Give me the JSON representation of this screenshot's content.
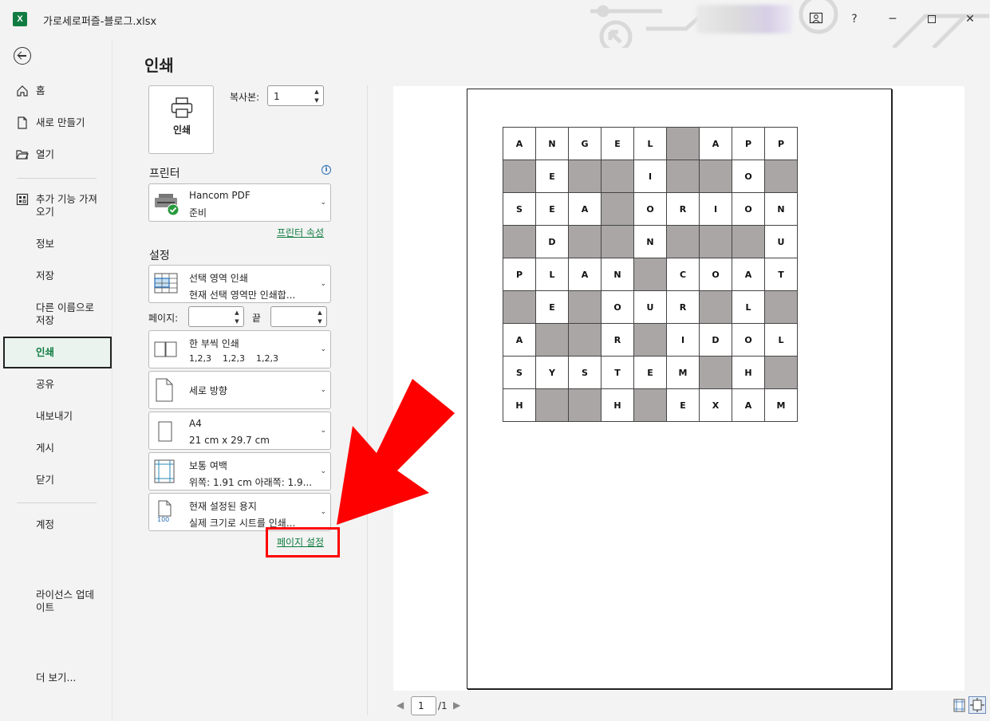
{
  "titlebar": {
    "app_icon_text": "X",
    "doc_title": "가로세로퍼즐-블로그.xlsx",
    "help": "?",
    "minimize": "─",
    "close": "✕"
  },
  "nav": {
    "home": "홈",
    "new": "새로 만들기",
    "open": "열기",
    "addins_line1": "추가 기능 가져",
    "addins_line2": "오기",
    "info": "정보",
    "save": "저장",
    "saveas_line1": "다른 이름으로",
    "saveas_line2": "저장",
    "print": "인쇄",
    "share": "공유",
    "export": "내보내기",
    "publish": "게시",
    "close": "닫기",
    "account": "계정",
    "license_line1": "라이선스 업데",
    "license_line2": "이트",
    "more": "더 보기..."
  },
  "print": {
    "title": "인쇄",
    "print_button": "인쇄",
    "copies_label": "복사본:",
    "copies_value": "1"
  },
  "printer": {
    "section": "프린터",
    "name": "Hancom PDF",
    "status": "준비",
    "properties_link": "프린터 속성"
  },
  "settings": {
    "section": "설정",
    "area_title": "선택 영역 인쇄",
    "area_desc": "현재 선택 영역만 인쇄합...",
    "pages_label": "페이지:",
    "to_label": "끝",
    "collate_title": "한 부씩 인쇄",
    "collate_desc": "1,2,3    1,2,3    1,2,3",
    "orientation": "세로 방향",
    "paper_title": "A4",
    "paper_desc": "21 cm x 29.7 cm",
    "margins_title": "보통 여백",
    "margins_desc": "위쪽: 1.91 cm 아래쪽: 1.9...",
    "scaling_title": "현재 설정된 용지",
    "scaling_desc": "실제 크기로 시트를 인쇄...",
    "scaling_icon_text": "100",
    "page_setup_link": "페이지 설정"
  },
  "preview": {
    "page_current": "1",
    "page_total": "/1",
    "grid": [
      [
        "A",
        "N",
        "G",
        "E",
        "L",
        "#",
        "A",
        "P",
        "P"
      ],
      [
        "#",
        "E",
        "#",
        "#",
        "I",
        "#",
        "#",
        "O",
        "#"
      ],
      [
        "S",
        "E",
        "A",
        "#",
        "O",
        "R",
        "I",
        "O",
        "N"
      ],
      [
        "#",
        "D",
        "#",
        "#",
        "N",
        "#",
        "#",
        "#",
        "U"
      ],
      [
        "P",
        "L",
        "A",
        "N",
        "#",
        "C",
        "O",
        "A",
        "T"
      ],
      [
        "#",
        "E",
        "#",
        "O",
        "U",
        "R",
        "#",
        "L",
        "#"
      ],
      [
        "A",
        "#",
        "#",
        "R",
        "#",
        "I",
        "D",
        "O",
        "L"
      ],
      [
        "S",
        "Y",
        "S",
        "T",
        "E",
        "M",
        "#",
        "H",
        "#"
      ],
      [
        "H",
        "#",
        "#",
        "H",
        "#",
        "E",
        "X",
        "A",
        "M"
      ]
    ]
  },
  "colors": {
    "accent": "#107c41",
    "annotation": "#ff0000",
    "blocked_cell": "#aaa6a6"
  }
}
